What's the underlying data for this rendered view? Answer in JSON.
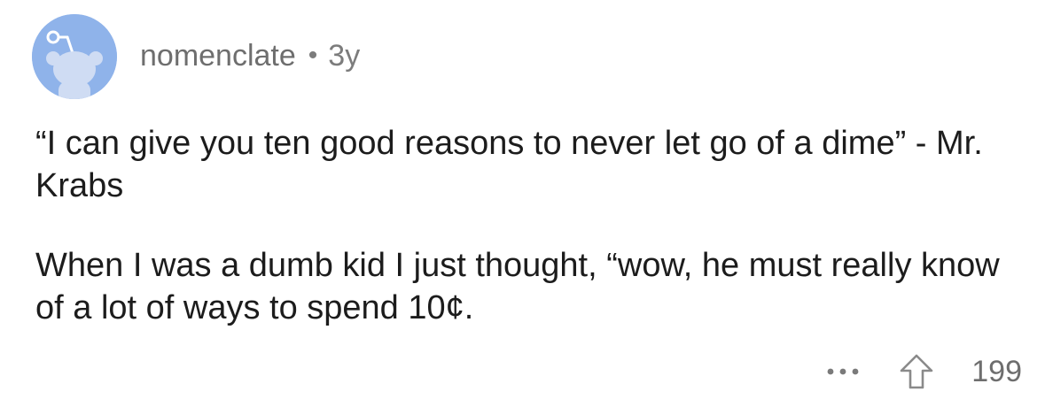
{
  "comment": {
    "author": "nomenclate",
    "separator": "•",
    "age": "3y",
    "avatar_icon": "reddit-snoo-avatar-icon",
    "avatar_color": "#8fb3ea",
    "paragraphs": [
      "“I can give you ten good reasons to never let go of a dime” - Mr. Krabs",
      "When I was a dumb kid I just thought, “wow, he must really know of a lot of ways to spend 10¢."
    ],
    "actions": {
      "more_icon": "more-options-icon",
      "upvote_icon": "upvote-arrow-icon",
      "score": "199"
    }
  }
}
